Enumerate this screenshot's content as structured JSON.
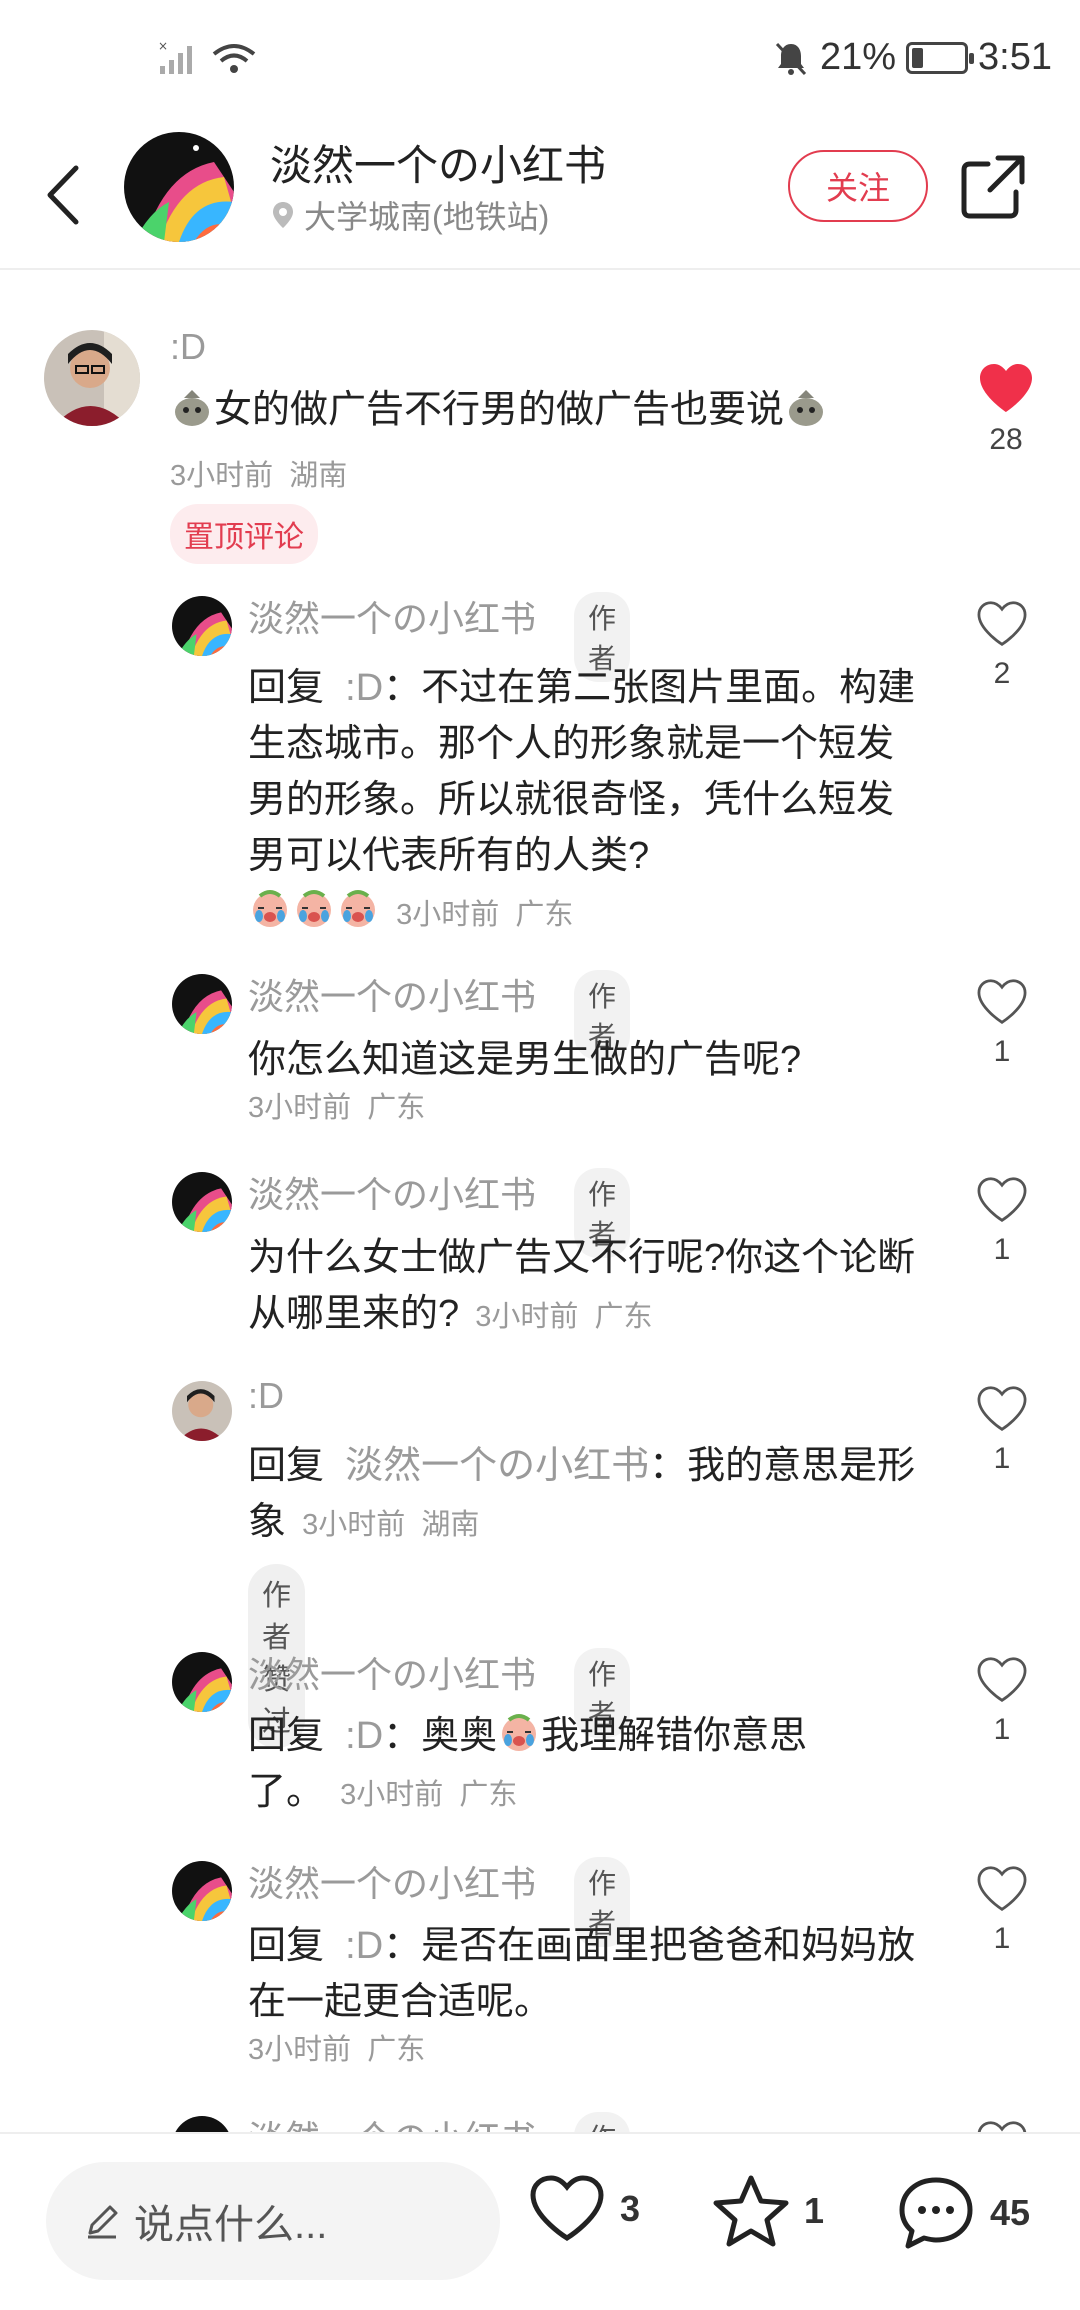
{
  "status_bar": {
    "battery_percent": "21%",
    "battery_level": 0.21,
    "time": "3:51",
    "icons": [
      "signal-icon",
      "wifi-icon",
      "bell-muted-icon",
      "battery-icon"
    ]
  },
  "header": {
    "username": "淡然一个の小红书",
    "location": "大学城南(地铁站)",
    "follow_label": "关注",
    "icons": [
      "back-arrow-icon",
      "share-icon",
      "location-pin-icon"
    ]
  },
  "main_comment": {
    "username": ":D",
    "text": "女的做广告不行男的做广告也要说",
    "time": "3小时前",
    "region": "湖南",
    "pinned_label": "置顶评论",
    "likes": "28",
    "liked": true
  },
  "replies": [
    {
      "username": "淡然一个の小红书",
      "badge": "作者",
      "reply_prefix": "回复",
      "reply_target": ":D",
      "text": "不过在第二张图片里面。构建生态城市。那个人的形象就是一个短发男的形象。所以就很奇怪，凭什么短发男可以代表所有的人类?",
      "time": "3小时前",
      "region": "广东",
      "likes": "2"
    },
    {
      "username": "淡然一个の小红书",
      "badge": "作者",
      "text": "你怎么知道这是男生做的广告呢?",
      "time": "3小时前",
      "region": "广东",
      "likes": "1"
    },
    {
      "username": "淡然一个の小红书",
      "badge": "作者",
      "text": "为什么女士做广告又不行呢?你这个论断从哪里来的?",
      "time": "3小时前",
      "region": "广东",
      "likes": "1"
    },
    {
      "username": ":D",
      "reply_prefix": "回复",
      "reply_target": "淡然一个の小红书",
      "text": "我的意思是形象",
      "time": "3小时前",
      "region": "湖南",
      "extra_badge": "作者赞过",
      "likes": "1"
    },
    {
      "username": "淡然一个の小红书",
      "badge": "作者",
      "reply_prefix": "回复",
      "reply_target": ":D",
      "text_a": "奥奥",
      "text_b": "我理解错你意思了。",
      "time": "3小时前",
      "region": "广东",
      "likes": "1"
    },
    {
      "username": "淡然一个の小红书",
      "badge": "作者",
      "reply_prefix": "回复",
      "reply_target": ":D",
      "text": "是否在画面里把爸爸和妈妈放在一起更合适呢。",
      "time": "3小时前",
      "region": "广东",
      "likes": "1"
    },
    {
      "username": "淡然一个の小红书",
      "badge": "作者"
    }
  ],
  "bottom_bar": {
    "input_placeholder": "说点什么...",
    "like_count": "3",
    "star_count": "1",
    "comment_count": "45"
  },
  "colors": {
    "accent": "#e23c4f",
    "muted_text": "#9a9a9a"
  }
}
